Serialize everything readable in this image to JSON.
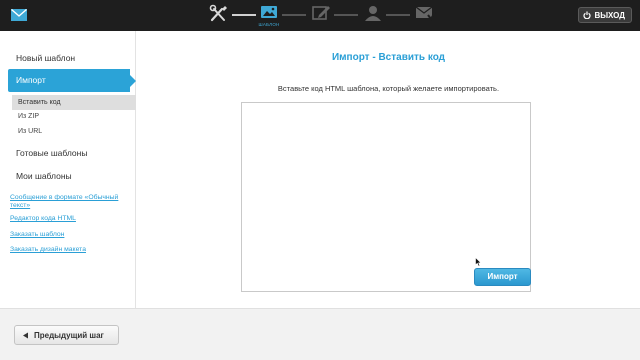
{
  "header": {
    "logo_icon": "envelope-icon",
    "steps": [
      {
        "icon": "tools-icon",
        "label": ""
      },
      {
        "icon": "template-icon",
        "label": "ШАБЛОН"
      },
      {
        "icon": "edit-icon",
        "label": ""
      },
      {
        "icon": "contacts-icon",
        "label": ""
      },
      {
        "icon": "send-icon",
        "label": ""
      }
    ],
    "logout_label": "ВЫХОД",
    "accent_color": "#3fa9d6"
  },
  "sidebar": {
    "new_template": "Новый шаблон",
    "import": "Импорт",
    "import_sub": [
      "Вставить код",
      "Из ZIP",
      "Из URL"
    ],
    "ready_templates": "Готовые шаблоны",
    "my_templates": "Мои шаблоны",
    "links": [
      "Сообщение в формате «Обычный текст»",
      "Редактор кода HTML",
      "Заказать шаблон",
      "Заказать дизайн макета"
    ]
  },
  "main": {
    "title": "Импорт - Вставить код",
    "instruction": "Вставьте код HTML шаблона, который желаете импортировать.",
    "code_value": "",
    "import_button": "Импорт"
  },
  "footer": {
    "prev_button": "Предыдущий шаг"
  }
}
